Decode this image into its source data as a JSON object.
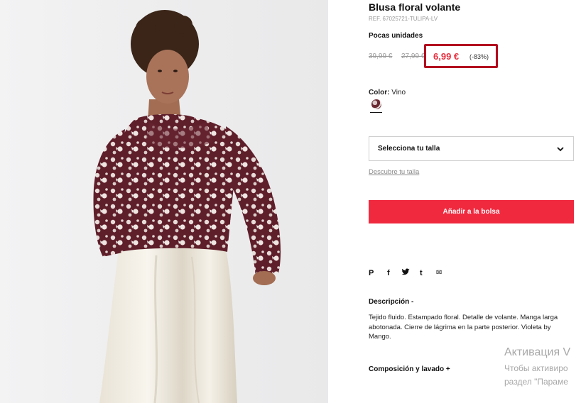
{
  "product": {
    "title": "Blusa floral volante",
    "ref": "REF. 67025721-TULIPA-LV",
    "stock_note": "Pocas unidades",
    "old_price_1": "39,99 €",
    "old_price_2": "27,99 €",
    "price": "6,99 €",
    "discount": "(-83%)",
    "highlight_color": "#b3081f",
    "price_color": "#e8303f"
  },
  "color": {
    "label": "Color:",
    "value": "Vino",
    "swatch_icon": "wine-floral-swatch"
  },
  "size": {
    "select_label": "Selecciona tu talla",
    "guide_link": "Descubre tu talla"
  },
  "cart": {
    "add_label": "Añadir a la bolsa",
    "button_color": "#f0293f"
  },
  "share": {
    "pinterest": "P",
    "facebook": "f",
    "twitter": "🐦",
    "tumblr": "t",
    "email": "✉"
  },
  "description": {
    "title": "Descripción -",
    "text": "Tejido fluido. Estampado floral. Detalle de volante. Manga larga abotonada. Cierre de lágrima en la parte posterior. Violeta by Mango."
  },
  "composition": {
    "title": "Composición y lavado +"
  },
  "watermark": {
    "line1": "Активация V",
    "line2": "Чтобы активиро",
    "line3": "раздел \"Параме"
  }
}
